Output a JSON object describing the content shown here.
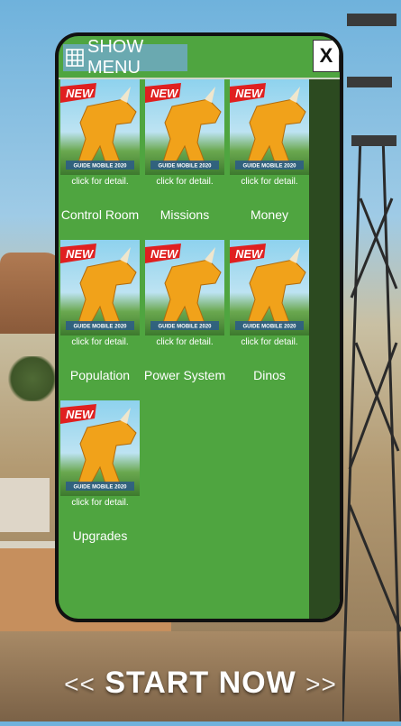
{
  "header": {
    "menu_label": "SHOW MENU",
    "close_label": "X"
  },
  "tiles": [
    {
      "title": "Control Room",
      "detail": "click for detail.",
      "badge": "NEW",
      "caption": "GUIDE MOBILE 2020"
    },
    {
      "title": "Missions",
      "detail": "click for detail.",
      "badge": "NEW",
      "caption": "GUIDE MOBILE 2020"
    },
    {
      "title": "Money",
      "detail": "click for detail.",
      "badge": "NEW",
      "caption": "GUIDE MOBILE 2020"
    },
    {
      "title": "Population",
      "detail": "click for detail.",
      "badge": "NEW",
      "caption": "GUIDE MOBILE 2020"
    },
    {
      "title": "Power System",
      "detail": "click for detail.",
      "badge": "NEW",
      "caption": "GUIDE MOBILE 2020"
    },
    {
      "title": "Dinos",
      "detail": "click for detail.",
      "badge": "NEW",
      "caption": "GUIDE MOBILE 2020"
    },
    {
      "title": "Upgrades",
      "detail": "click for detail.",
      "badge": "NEW",
      "caption": "GUIDE MOBILE 2020"
    }
  ],
  "footer": {
    "start_label": "START NOW",
    "left_chevrons": "<<",
    "right_chevrons": ">>"
  },
  "colors": {
    "panel_green": "#4fa540",
    "menu_button": "#6aa9b0",
    "badge_red": "#e02020"
  }
}
